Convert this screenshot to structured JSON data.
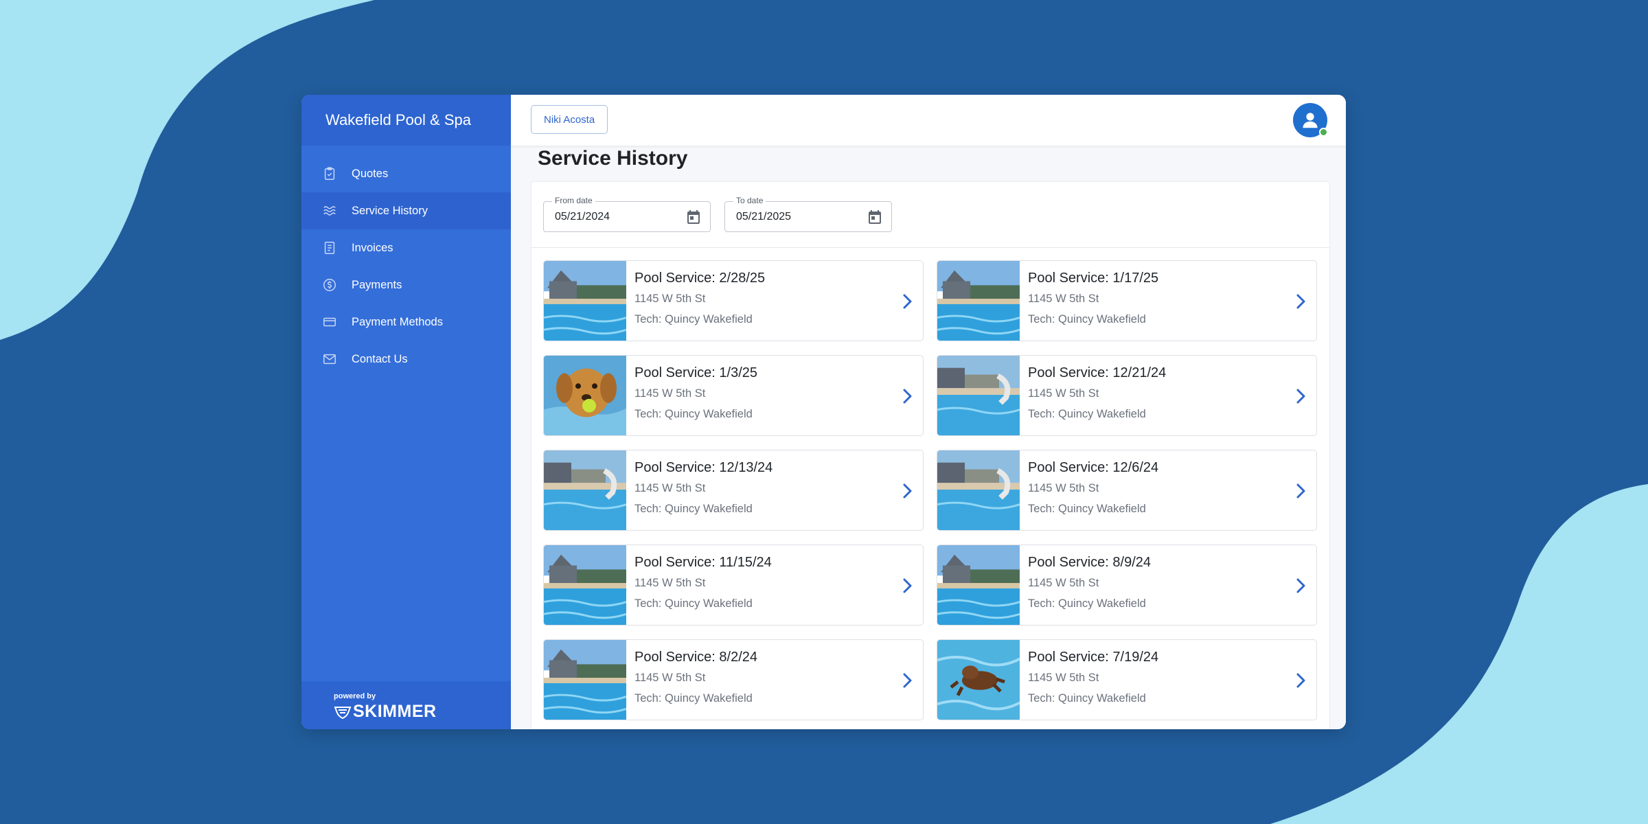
{
  "colors": {
    "background_dark": "#215d9c",
    "background_light": "#a6e3f3",
    "sidebar": "#346ed9",
    "sidebar_header": "#2d64d0",
    "accent": "#2f66cc",
    "avatar": "#1f6fcf",
    "online": "#4caf50"
  },
  "sidebar": {
    "brand": "Wakefield Pool & Spa",
    "items": [
      {
        "label": "Quotes",
        "icon": "clipboard-check-icon",
        "active": false
      },
      {
        "label": "Service History",
        "icon": "waves-icon",
        "active": true
      },
      {
        "label": "Invoices",
        "icon": "document-icon",
        "active": false
      },
      {
        "label": "Payments",
        "icon": "dollar-circle-icon",
        "active": false
      },
      {
        "label": "Payment Methods",
        "icon": "credit-card-icon",
        "active": false
      },
      {
        "label": "Contact Us",
        "icon": "envelope-icon",
        "active": false
      }
    ],
    "powered_by": "powered by",
    "powered_brand": "SKIMMER"
  },
  "header": {
    "user_chip": "Niki Acosta",
    "avatar_icon": "user-avatar-icon"
  },
  "page": {
    "title": "Service History"
  },
  "filters": {
    "from_label": "From date",
    "from_value": "05/21/2024",
    "to_label": "To date",
    "to_value": "05/21/2025",
    "calendar_icon": "calendar-icon"
  },
  "services": [
    {
      "title": "Pool Service: 2/28/25",
      "address": "1145 W 5th St",
      "tech": "Tech: Quincy Wakefield",
      "photo": "pool-house-photo"
    },
    {
      "title": "Pool Service: 1/17/25",
      "address": "1145 W 5th St",
      "tech": "Tech: Quincy Wakefield",
      "photo": "pool-house-photo"
    },
    {
      "title": "Pool Service: 1/3/25",
      "address": "1145 W 5th St",
      "tech": "Tech: Quincy Wakefield",
      "photo": "dog-with-ball-photo"
    },
    {
      "title": "Pool Service: 12/21/24",
      "address": "1145 W 5th St",
      "tech": "Tech: Quincy Wakefield",
      "photo": "pool-slide-photo"
    },
    {
      "title": "Pool Service: 12/13/24",
      "address": "1145 W 5th St",
      "tech": "Tech: Quincy Wakefield",
      "photo": "pool-slide-photo"
    },
    {
      "title": "Pool Service: 12/6/24",
      "address": "1145 W 5th St",
      "tech": "Tech: Quincy Wakefield",
      "photo": "pool-slide-photo"
    },
    {
      "title": "Pool Service: 11/15/24",
      "address": "1145 W 5th St",
      "tech": "Tech: Quincy Wakefield",
      "photo": "pool-house-photo"
    },
    {
      "title": "Pool Service: 8/9/24",
      "address": "1145 W 5th St",
      "tech": "Tech: Quincy Wakefield",
      "photo": "pool-house-photo"
    },
    {
      "title": "Pool Service: 8/2/24",
      "address": "1145 W 5th St",
      "tech": "Tech: Quincy Wakefield",
      "photo": "pool-house-photo"
    },
    {
      "title": "Pool Service: 7/19/24",
      "address": "1145 W 5th St",
      "tech": "Tech: Quincy Wakefield",
      "photo": "dog-swimming-photo"
    }
  ]
}
